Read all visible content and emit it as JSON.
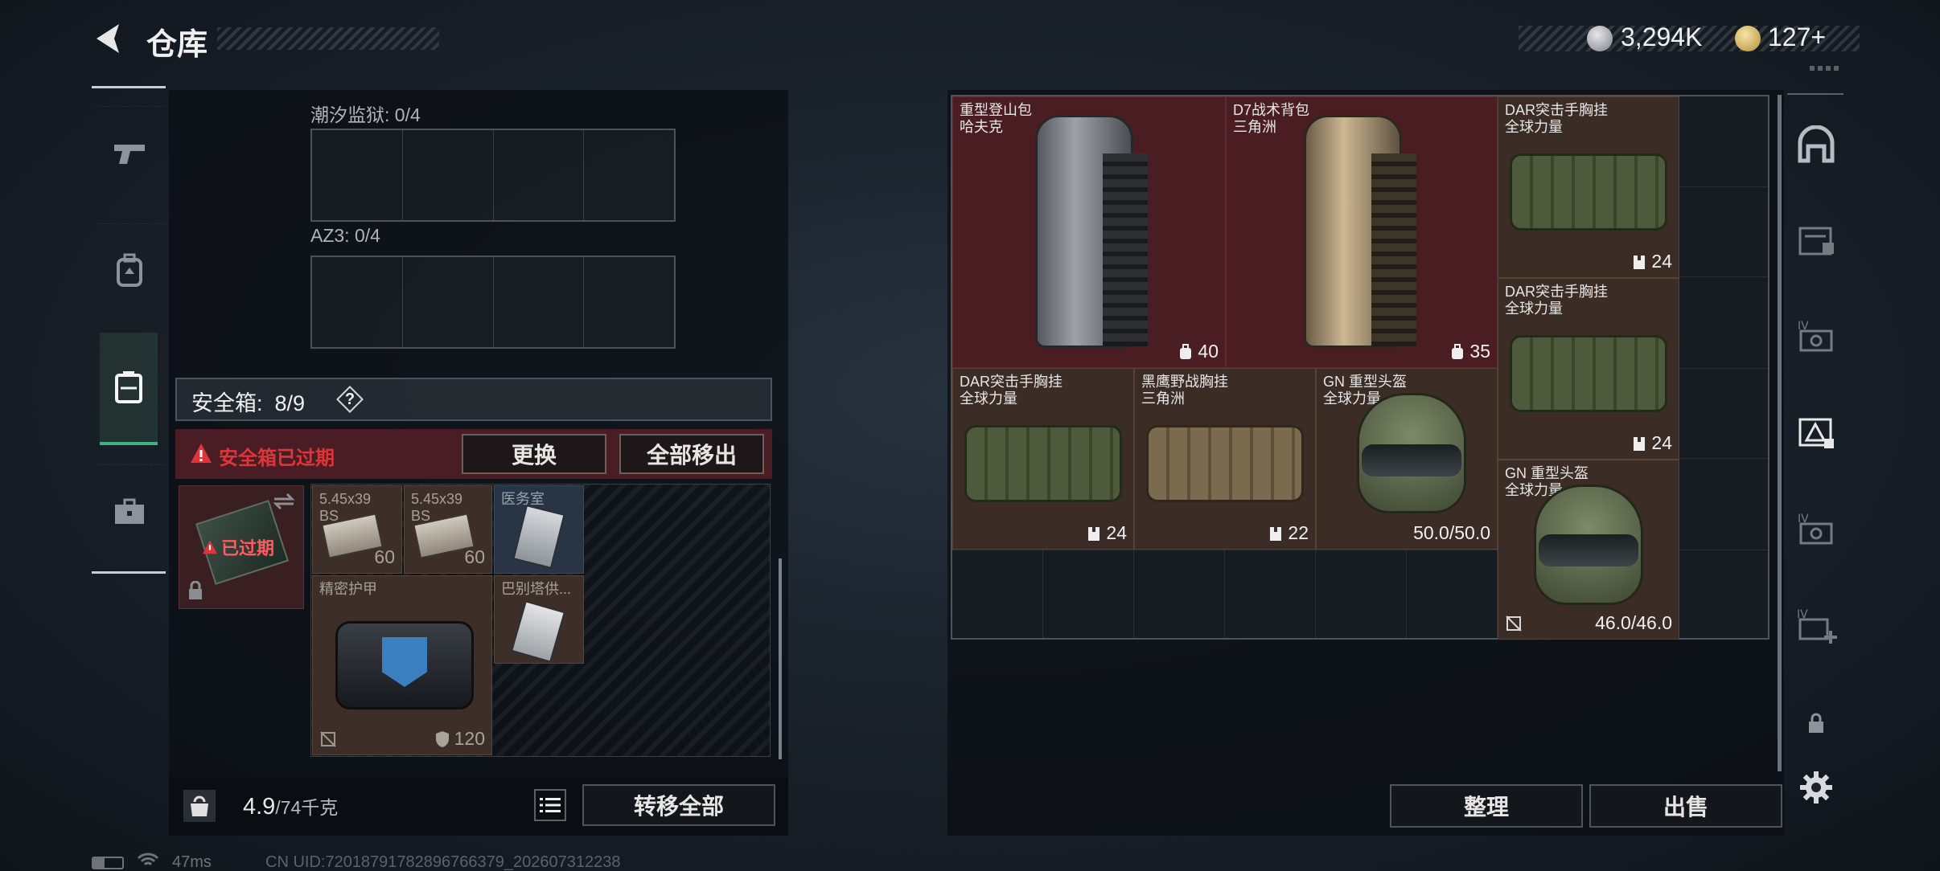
{
  "header": {
    "title": "仓库",
    "currency1": "3,294K",
    "currency2": "127+"
  },
  "left_sidebar": {
    "items": [
      "pistol-tab",
      "backpack-tab",
      "safebox-tab",
      "toolbox-tab"
    ]
  },
  "containers": {
    "chaoxi": {
      "label": "潮汐监狱: 0/4"
    },
    "az3": {
      "label": "AZ3: 0/4"
    }
  },
  "safebox": {
    "label": "安全箱:  8/9",
    "help": "?",
    "expired_warning": "安全箱已过期",
    "replace_button": "更换",
    "remove_all_button": "全部移出",
    "expired_badge": "已过期",
    "items": [
      {
        "name": "5.45x39\nBS",
        "count": "60"
      },
      {
        "name": "5.45x39\nBS",
        "count": "60"
      },
      {
        "name": "医务室",
        "count": ""
      },
      {
        "name": "精密护甲",
        "count": "120"
      },
      {
        "name": "巴别塔供...",
        "count": ""
      }
    ]
  },
  "footer": {
    "weight": "4.9",
    "weight_max": "/74千克",
    "transfer_all_button": "转移全部",
    "ping": "47ms",
    "uid": "CN UID:72018791782896766379_202607312238"
  },
  "storage": {
    "items": [
      {
        "name": "重型登山包\n哈夫克",
        "count": "40",
        "color": "red"
      },
      {
        "name": "D7战术背包\n三角洲",
        "count": "35",
        "color": "red"
      },
      {
        "name": "DAR突击手胸挂\n全球力量",
        "count": "24",
        "color": "brown"
      },
      {
        "name": "DAR突击手胸挂\n全球力量",
        "count": "24",
        "color": "brown"
      },
      {
        "name": "DAR突击手胸挂\n全球力量",
        "count": "24",
        "color": "brown"
      },
      {
        "name": "黑鹰野战胸挂\n三角洲",
        "count": "22",
        "color": "brown"
      },
      {
        "name": "GN 重型头盔\n全球力量",
        "count": "50.0/50.0",
        "color": "brown"
      },
      {
        "name": "GN 重型头盔\n全球力量",
        "count": "46.0/46.0",
        "color": "brown"
      }
    ],
    "sort_button": "整理",
    "sell_button": "出售"
  },
  "colors": {
    "accent_green": "#3fb27f",
    "warning_red": "#e0343b",
    "panel_red": "#4a1d22",
    "panel_brown": "#3c2c26"
  }
}
